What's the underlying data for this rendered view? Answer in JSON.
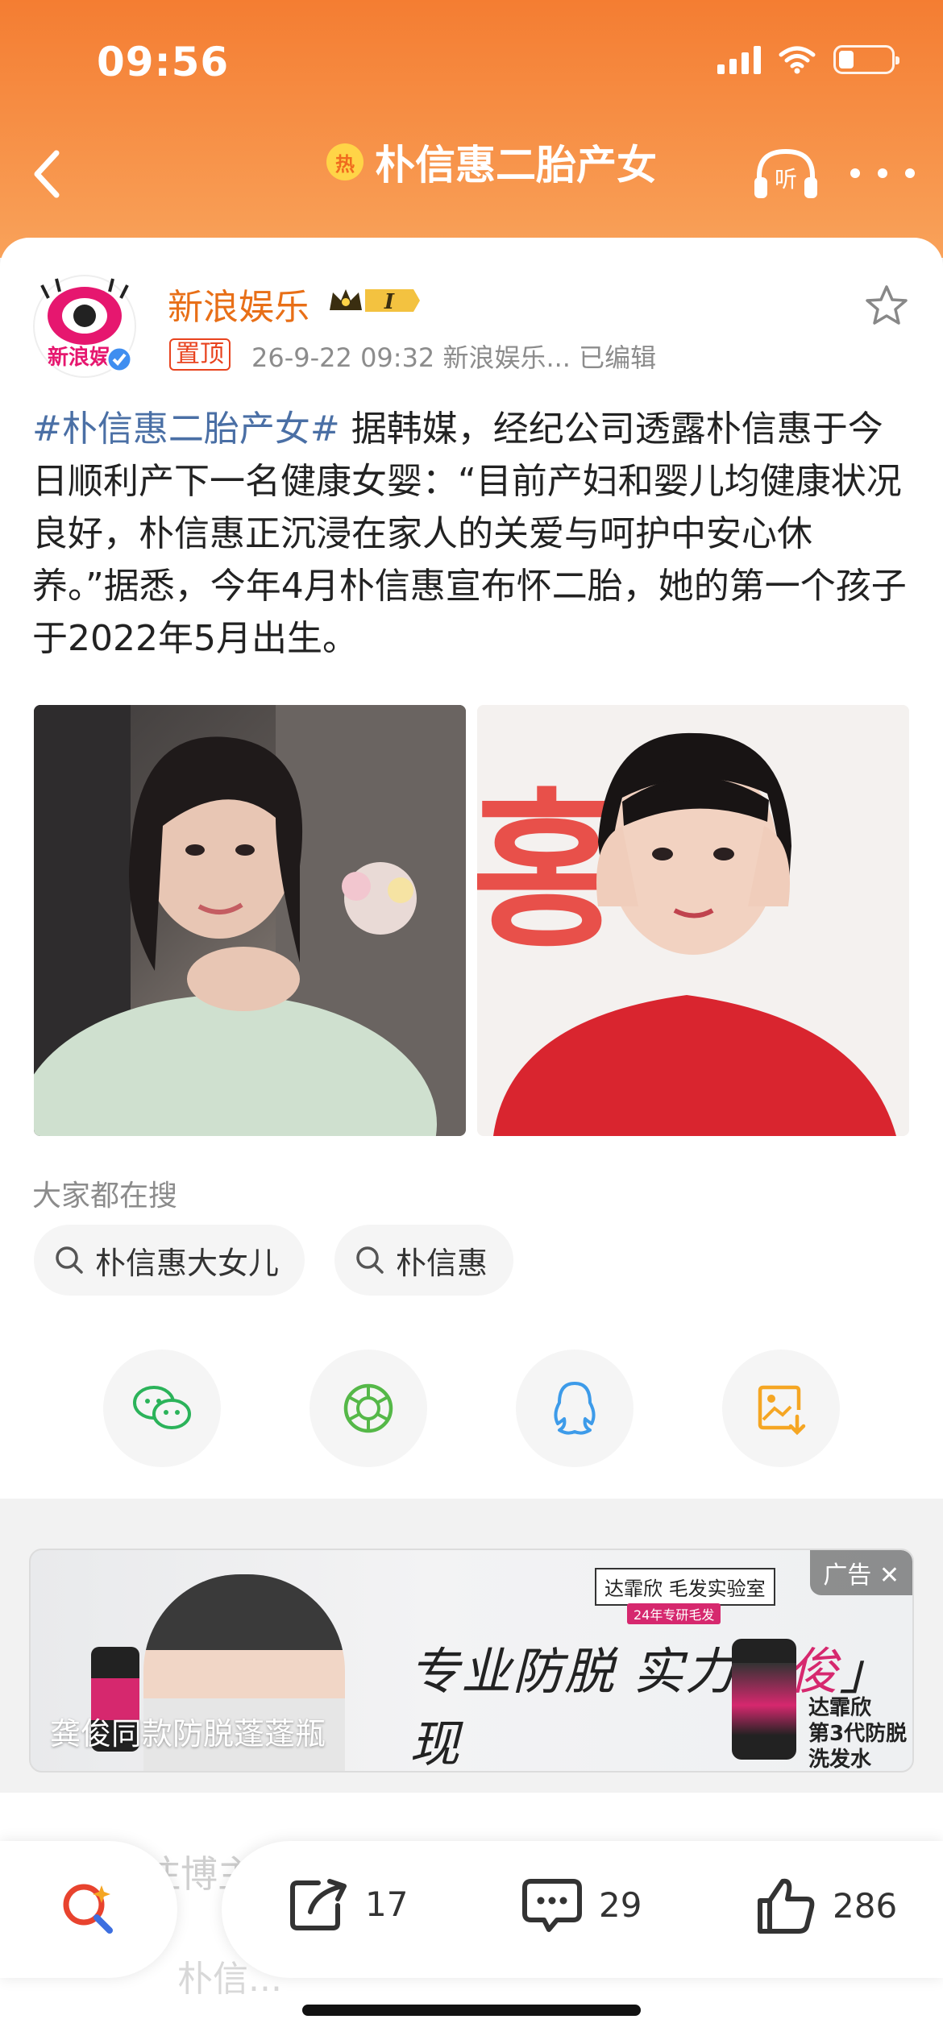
{
  "status_bar": {
    "time": "09:56"
  },
  "nav": {
    "hot_badge": "热",
    "title": "朴信惠二胎产女",
    "listen_label": "听"
  },
  "post": {
    "author": "新浪娱乐",
    "avatar_text": "新浪娱",
    "level_badge": "I",
    "pin_tag": "置顶",
    "meta": "26-9-22 09:32  新浪娱乐...  已编辑",
    "hashtag": "#朴信惠二胎产女#",
    "body": " 据韩媒，经纪公司透露朴信惠于今日顺利产下一名健康女婴：“目前产妇和婴儿均健康状况良好，朴信惠正沉浸在家人的关爱与呵护中安心休养。”据悉，今年4月朴信惠宣布怀二胎，她的第一个孩子于2022年5月出生。",
    "photo2_sign_text": "홍"
  },
  "search": {
    "title": "大家都在搜",
    "chips": [
      "朴信惠大女儿",
      "朴信惠"
    ]
  },
  "share": {
    "buttons": [
      "wechat-icon",
      "moments-icon",
      "qq-icon",
      "save-image-icon"
    ],
    "colors": {
      "wechat": "#2bb35a",
      "moments": "#55b848",
      "qq": "#3d9be9",
      "save": "#f5a623"
    }
  },
  "ad": {
    "tag": "广告",
    "close": "✕",
    "caption": "龚俊同款防脱蓬蓬瓶",
    "slogan_a": "专业防脱 实力「",
    "slogan_b": "俊",
    "slogan_c": "」现",
    "brand": "达霏欣 毛发实验室",
    "brand_sub": "24年专研毛发",
    "product_line1": "达霏欣",
    "product_line2": "第3代防脱洗发水"
  },
  "recommend": {
    "title": "推荐关注博主",
    "peek_name": "朴信..."
  },
  "actions": {
    "repost": "17",
    "comment": "29",
    "like": "286"
  },
  "colors": {
    "header": "#f47d32",
    "accent": "#e86f17",
    "hashtag": "#4a6fa5",
    "pin": "#e8431e"
  }
}
